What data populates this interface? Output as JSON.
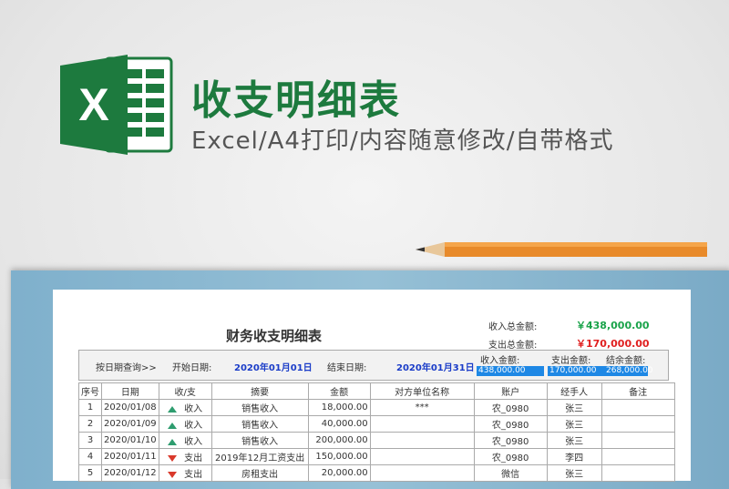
{
  "banner": {
    "title": "收支明细表",
    "subtitle": "Excel/A4打印/内容随意修改/自带格式",
    "logo_letter": "X",
    "logo_color": "#1d7a3e"
  },
  "sheet": {
    "title": "财务收支明细表",
    "summary": {
      "income_label": "收入总金额:",
      "income_value": "￥438,000.00",
      "income_color": "#1aa34a",
      "expense_label": "支出总金额:",
      "expense_value": "￥170,000.00",
      "expense_color": "#e02020"
    },
    "filter": {
      "query_label": "按日期查询>>",
      "start_label": "开始日期:",
      "start_value": "2020年01月01日",
      "end_label": "结束日期:",
      "end_value": "2020年01月31日",
      "income_label": "收入金额:",
      "income_value": "438,000.00",
      "expense_label": "支出金额:",
      "expense_value": "170,000.00",
      "balance_label": "结余金额:",
      "balance_value": "268,000.00"
    },
    "columns": [
      "序号",
      "日期",
      "收/支",
      "摘要",
      "金额",
      "对方单位名称",
      "账户",
      "经手人",
      "备注"
    ],
    "rows": [
      {
        "no": "1",
        "date": "2020/01/08",
        "dir": "up",
        "type": "收入",
        "summary": "销售收入",
        "amount": "18,000.00",
        "party": "***",
        "account": "农_0980",
        "handler": "张三",
        "note": ""
      },
      {
        "no": "2",
        "date": "2020/01/09",
        "dir": "up",
        "type": "收入",
        "summary": "销售收入",
        "amount": "40,000.00",
        "party": "",
        "account": "农_0980",
        "handler": "张三",
        "note": ""
      },
      {
        "no": "3",
        "date": "2020/01/10",
        "dir": "up",
        "type": "收入",
        "summary": "销售收入",
        "amount": "200,000.00",
        "party": "",
        "account": "农_0980",
        "handler": "张三",
        "note": ""
      },
      {
        "no": "4",
        "date": "2020/01/11",
        "dir": "down",
        "type": "支出",
        "summary": "2019年12月工资支出",
        "amount": "150,000.00",
        "party": "",
        "account": "农_0980",
        "handler": "李四",
        "note": ""
      },
      {
        "no": "5",
        "date": "2020/01/12",
        "dir": "down",
        "type": "支出",
        "summary": "房租支出",
        "amount": "20,000.00",
        "party": "",
        "account": "微信",
        "handler": "张三",
        "note": ""
      }
    ]
  }
}
